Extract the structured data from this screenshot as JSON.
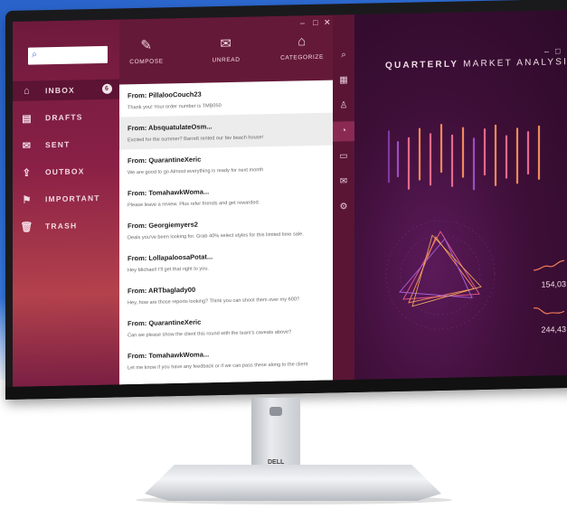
{
  "mail": {
    "search_icon": "search-icon",
    "nav": [
      {
        "label": "INBOX",
        "icon": "inbox-icon",
        "badge": "6"
      },
      {
        "label": "DRAFTS",
        "icon": "drafts-icon"
      },
      {
        "label": "SENT",
        "icon": "sent-icon"
      },
      {
        "label": "OUTBOX",
        "icon": "outbox-icon"
      },
      {
        "label": "IMPORTANT",
        "icon": "flag-icon"
      },
      {
        "label": "TRASH",
        "icon": "trash-icon"
      }
    ],
    "toolbar": {
      "compose": "COMPOSE",
      "unread": "UNREAD",
      "categorize": "CATEGORIZE"
    },
    "messages": [
      {
        "from": "From: PillalooCouch23",
        "preview": "Thank you! Your order number is TMB050"
      },
      {
        "from": "From: AbsquatulateOsm...",
        "preview": "Excited for the summer? Barrett rented our fav beach house!"
      },
      {
        "from": "From: QuarantineXeric",
        "preview": "We are good to go Almost everything is ready for next month"
      },
      {
        "from": "From: TomahawkWoma...",
        "preview": "Please leave a review. Plus refer friends and get rewarded."
      },
      {
        "from": "From: Georgiemyers2",
        "preview": "Deals you've been looking for. Grab 40% select styles for this limited time sale."
      },
      {
        "from": "From: LollapaloosaPotat...",
        "preview": "Hey Michael! I'll get that right to you."
      },
      {
        "from": "From: ARTbaglady00",
        "preview": "Hey, how are those reports looking? Think you can shoot them over my 600?"
      },
      {
        "from": "From: QuarantineXeric",
        "preview": "Can we please show the client this round with the team's caveats above?"
      },
      {
        "from": "From: TomahawkWoma...",
        "preview": "Let me know if you have any feedback or if we can pass these along to the client"
      }
    ]
  },
  "analysis": {
    "title_bold": "QUARTERLY",
    "title_rest": " MARKET ANALYSIS",
    "stat1": "154,03",
    "stat2": "244,43"
  },
  "brand": {
    "logo": "DELL"
  },
  "colors": {
    "accent": "#8a2046",
    "bg": "#2f6fd8"
  }
}
